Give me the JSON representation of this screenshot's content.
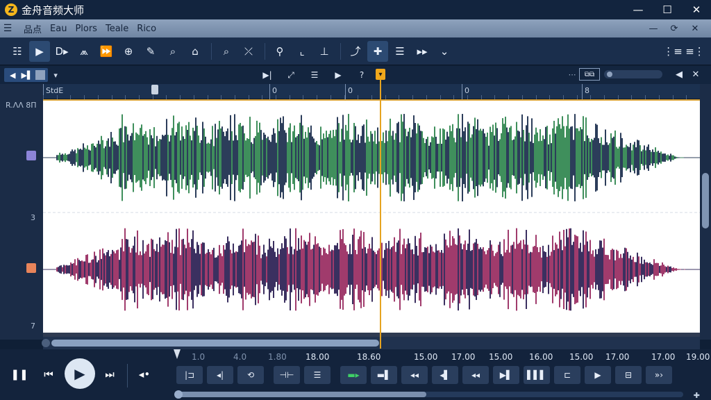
{
  "app": {
    "title": "金舟音频大师",
    "logo_letter": "Z",
    "minimize_icon": "minimize-icon",
    "maximize_icon": "maximize-icon",
    "close_icon": "close-icon"
  },
  "menu": {
    "hamburger": "☰",
    "items": [
      "品点",
      "Eau",
      "Plors",
      "Teale",
      "Rico"
    ],
    "right_icons": [
      "—",
      "⟳",
      "✕"
    ]
  },
  "toolbar": {
    "icons": [
      "list-icon",
      "play-select-icon",
      "cursor-icon",
      "waveform-icon",
      "forward-icon",
      "zoom-in-icon",
      "brush-icon",
      "search-icon",
      "lock-icon",
      "search-icon-2",
      "magic-wand-icon",
      "zoom-icon",
      "crop-icon",
      "anchor-icon",
      "envelope-icon",
      "add-marker-icon",
      "list-icon-2",
      "forward-icon-2",
      "chevron-down-icon"
    ],
    "glyphs": [
      "☷",
      "▶",
      "D▸",
      "⩕",
      "⏩",
      "⊕",
      "✎",
      "⌕",
      "⌂",
      "⌕",
      "⤫",
      "⚲",
      "⌞",
      "⊥",
      "⤴",
      "✚",
      "☰",
      "▸▸",
      "⌄"
    ],
    "right_glyphs": [
      "⋮≡",
      "≡⋮"
    ]
  },
  "subbar": {
    "left_glyphs": [
      "◀",
      "▶▌"
    ],
    "caret": "▾",
    "mid_glyphs": [
      "▶|",
      "⤢",
      "☰",
      "▶",
      "?"
    ],
    "marker_glyph": "▾",
    "zoom_label": "⧉⧉",
    "dots": "⋯",
    "right_glyphs": [
      "◀",
      "✕"
    ]
  },
  "ruler": {
    "labels": [
      {
        "text": "StdE",
        "pos": 0.0
      },
      {
        "text": "0",
        "pos": 0.345
      },
      {
        "text": "0",
        "pos": 0.46
      },
      {
        "text": "0",
        "pos": 0.637
      },
      {
        "text": "8",
        "pos": 0.82
      }
    ]
  },
  "gutter": {
    "labels": [
      "R.ΛΛ 8Π",
      "3",
      "7"
    ],
    "channel_colors": [
      "#8c84d8",
      "#e8845a"
    ]
  },
  "waveform": {
    "channel_top_color": "#3f8f5c",
    "channel_top_dark": "#2c3d5a",
    "channel_bottom_color": "#a03b6c",
    "channel_bottom_dark": "#3b3060",
    "playhead_color": "#e6a421"
  },
  "transport": {
    "pause_glyph": "❚❚",
    "prev_glyph": "⏮",
    "play_glyph": "▶",
    "next_glyph": "⏭",
    "loop_glyph": "◂•",
    "timeline_labels": [
      {
        "text": "1.0",
        "dim": true
      },
      {
        "text": "4.0",
        "dim": true
      },
      {
        "text": "1.80",
        "dim": true
      },
      {
        "text": "18.00",
        "dim": false
      },
      {
        "text": "18.60",
        "dim": false
      },
      {
        "text": "15.00",
        "dim": false
      },
      {
        "text": "17.00",
        "dim": false
      },
      {
        "text": "15.00",
        "dim": false
      },
      {
        "text": "16.00",
        "dim": false
      },
      {
        "text": "15.00",
        "dim": false
      },
      {
        "text": "17.00",
        "dim": false
      },
      {
        "text": "17.00",
        "dim": false
      },
      {
        "text": "19.00",
        "dim": false
      }
    ],
    "control_glyphs": [
      "|⊐",
      "◂|",
      "⟲",
      "⊣⊢",
      "☰",
      "▬▸",
      "▬▌",
      "◂◂",
      "◂▌",
      "◂◂",
      "▶▌",
      "▌▌▌",
      "⊏",
      "▶",
      "⊟",
      "»›"
    ],
    "bottom_right": "✚"
  }
}
